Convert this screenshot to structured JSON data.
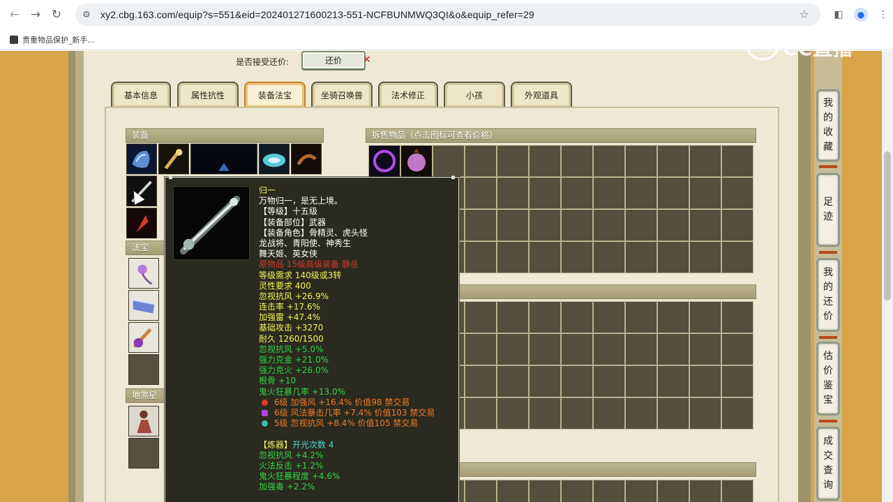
{
  "browser": {
    "url": "xy2.cbg.163.com/equip?s=551&eid=202401271600213-551-NCFBUNMWQ3QI&o&equip_refer=29",
    "bookmark": "贵重物品保护_新手..."
  },
  "watermark": "CC直播",
  "counter_offer": {
    "label": "是否接受还价:",
    "button": "还价"
  },
  "tabs": [
    {
      "label": "基本信息"
    },
    {
      "label": "属性抗性"
    },
    {
      "label": "装备法宝",
      "active": true
    },
    {
      "label": "坐骑召唤兽"
    },
    {
      "label": "法术修正"
    },
    {
      "label": "小孩"
    },
    {
      "label": "外观道具"
    }
  ],
  "sections": {
    "equipment": "装备",
    "treasure": "法宝",
    "dibao": "地煞星",
    "sale_items": "拆售物品（点击图标可查看价格）"
  },
  "sidebar": [
    {
      "label": [
        "我",
        "的",
        "收",
        "藏"
      ]
    },
    {
      "label": [
        "足",
        "迹"
      ]
    },
    {
      "label": [
        "我",
        "的",
        "还",
        "价"
      ]
    },
    {
      "label": [
        "估",
        "价",
        "鉴",
        "宝"
      ]
    },
    {
      "label": [
        "成",
        "交",
        "查",
        "询"
      ]
    }
  ],
  "tooltip": {
    "name": "归一",
    "lines": [
      {
        "text": "万物归一，是无上境。",
        "color": "white"
      },
      {
        "text": "【等级】十五级",
        "color": "white"
      },
      {
        "text": "【装备部位】武器",
        "color": "white"
      },
      {
        "text": "【装备角色】骨精灵、虎头怪",
        "color": "white"
      },
      {
        "text": "龙战将、青阳使、神秀生",
        "color": "white"
      },
      {
        "text": "舞天姬、英女侠",
        "color": "white"
      },
      {
        "text": "原物品 15级高级装备 静岳",
        "color": "red"
      },
      {
        "text": "等级需求 140级或3转",
        "color": "yellow"
      },
      {
        "text": "灵性要求 400",
        "color": "yellow"
      },
      {
        "text": "忽视抗风 +26.9%",
        "color": "yellow"
      },
      {
        "text": "连击率 +17.6%",
        "color": "yellow"
      },
      {
        "text": "加强雷 +47.4%",
        "color": "yellow"
      },
      {
        "text": "基础攻击 +3270",
        "color": "yellow"
      },
      {
        "text": "耐久 1260/1500",
        "color": "yellow"
      },
      {
        "text": "忽视抗风 +5.0%",
        "color": "green"
      },
      {
        "text": "强力克金 +21.0%",
        "color": "green"
      },
      {
        "text": "强力克火 +26.0%",
        "color": "green"
      },
      {
        "text": "根骨 +10",
        "color": "green"
      },
      {
        "text": "鬼火狂暴几率 +13.0%",
        "color": "green"
      }
    ],
    "gems": [
      {
        "text": "6级 加强风 +16.4% 价值98 禁交易",
        "gem_color": "#e03b2c"
      },
      {
        "text": "6级 风法暴击几率 +7.4% 价值103 禁交易",
        "gem_color": "#b044e0"
      },
      {
        "text": "5级 忽视抗风 +8.4% 价值105 禁交易",
        "gem_color": "#36c0b0"
      }
    ],
    "refine_title": "【炼器】",
    "refine_count": "开光次数 4",
    "refine_lines": [
      "忽视抗风 +4.2%",
      "火法反击 +1.2%",
      "鬼火狂暴程度 +4.6%",
      "加强毒 +2.2%"
    ]
  }
}
